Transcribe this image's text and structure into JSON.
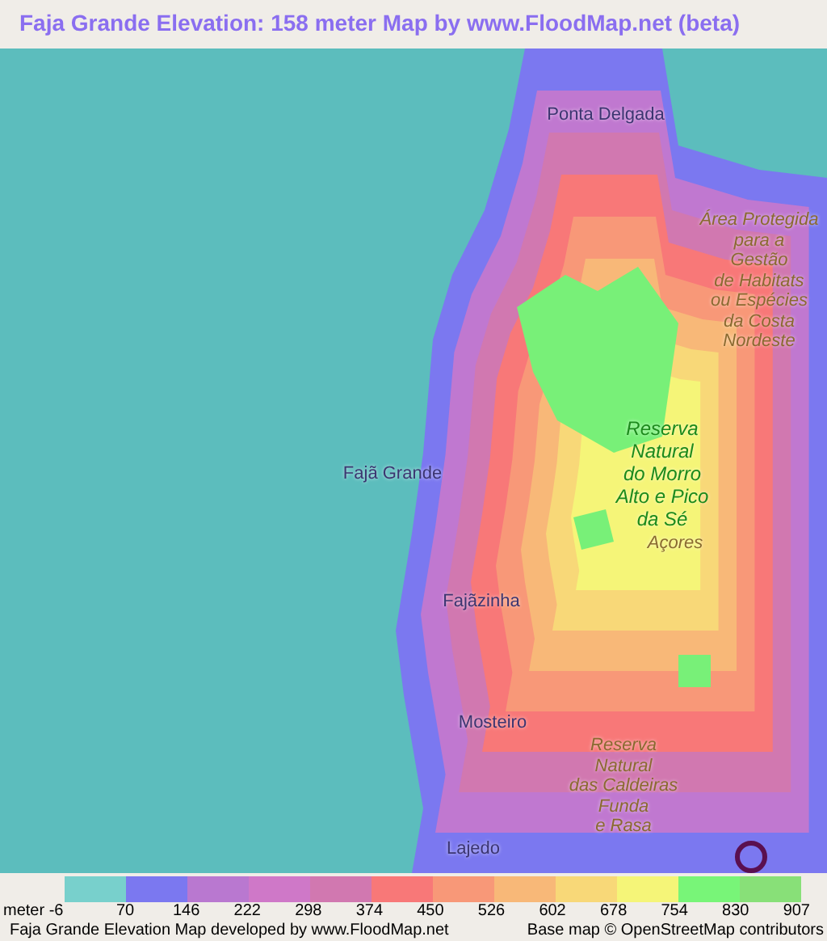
{
  "title": "Faja Grande Elevation: 158 meter Map by www.FloodMap.net (beta)",
  "map_labels": [
    {
      "kind": "place",
      "text": "Ponta Delgada"
    },
    {
      "kind": "area",
      "text": "Área Protegida\npara a\nGestão\nde Habitats\nou Espécies\nda Costa\nNordeste"
    },
    {
      "kind": "place",
      "text": "Fajã Grande"
    },
    {
      "kind": "reserve",
      "text": "Reserva\nNatural\ndo Morro\nAlto e Pico\nda Sé"
    },
    {
      "kind": "area",
      "text": "Açores"
    },
    {
      "kind": "place",
      "text": "Fajãzinha"
    },
    {
      "kind": "place",
      "text": "Mosteiro"
    },
    {
      "kind": "area",
      "text": "Reserva\nNatural\ndas Caldeiras\nFunda\ne Rasa"
    },
    {
      "kind": "place",
      "text": "Lajedo"
    }
  ],
  "legend": {
    "swatches": [
      {
        "color": "#78d0cc"
      },
      {
        "color": "#7b78f0"
      },
      {
        "color": "#b978d0"
      },
      {
        "color": "#cf78c8"
      },
      {
        "color": "#d178b0"
      },
      {
        "color": "#f87878"
      },
      {
        "color": "#f89878"
      },
      {
        "color": "#f8b878"
      },
      {
        "color": "#f8d878"
      },
      {
        "color": "#f5f578"
      },
      {
        "color": "#78f578"
      },
      {
        "color": "#88e078"
      }
    ],
    "ticks": [
      "meter -6",
      "70",
      "146",
      "222",
      "298",
      "374",
      "450",
      "526",
      "602",
      "678",
      "754",
      "830",
      "907"
    ]
  },
  "footer": {
    "left": "Faja Grande Elevation Map developed by www.FloodMap.net",
    "right": "Base map © OpenStreetMap contributors"
  }
}
